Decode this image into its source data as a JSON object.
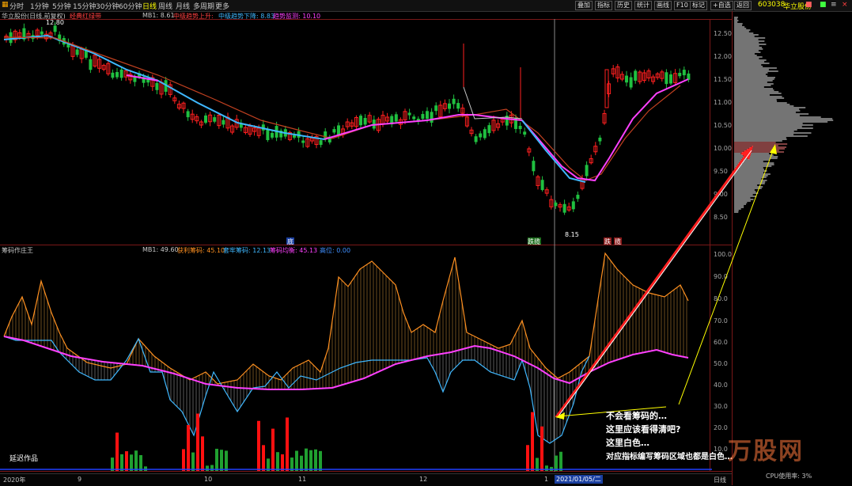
{
  "timeframes": [
    {
      "label": "分时",
      "active": false
    },
    {
      "label": "1分钟",
      "active": false
    },
    {
      "label": "5分钟",
      "active": false
    },
    {
      "label": "15分钟",
      "active": false
    },
    {
      "label": "30分钟",
      "active": false
    },
    {
      "label": "60分钟",
      "active": false
    },
    {
      "label": "日线",
      "active": true
    },
    {
      "label": "周线",
      "active": false
    },
    {
      "label": "月线",
      "active": false
    },
    {
      "label": "多周期",
      "active": false
    },
    {
      "label": "更多",
      "active": false
    }
  ],
  "toolbar": [
    "叠加",
    "指标",
    "历史",
    "统计",
    "画线",
    "F10",
    "标记",
    "+自选",
    "返回"
  ],
  "stock": {
    "code": "603038",
    "name": "华立股份"
  },
  "main_chart": {
    "title": "华立股份(日线,前复权)",
    "indicator": "经典红绿带",
    "legend": [
      {
        "text": "MB1: 8.61",
        "color": "#c8c8c8"
      },
      {
        "text": "中级趋势上升:",
        "color": "#ff4040"
      },
      {
        "text": "中级趋势下降: 8.83",
        "color": "#3fb8ff"
      },
      {
        "text": "趋势监测: 10.10",
        "color": "#ff40ff"
      }
    ],
    "price_labels": [
      "12.50",
      "12.00",
      "11.50",
      "11.00",
      "10.50",
      "10.00",
      "9.50",
      "9.00",
      "8.50"
    ],
    "high_mark": "12.80",
    "low_mark": "8.15",
    "signals": [
      "底",
      "跌揽",
      "跌",
      "揽"
    ]
  },
  "sub_chart": {
    "title": "筹码作庄王",
    "legend": [
      {
        "text": "MB1: 49.60",
        "color": "#c8c8c8"
      },
      {
        "text": "获利筹码: 45.10",
        "color": "#ff9020"
      },
      {
        "text": "套牢筹码: 12.13",
        "color": "#3fb8ff"
      },
      {
        "text": "筹码均衡: 45.13",
        "color": "#ff40ff"
      },
      {
        "text": "高位: 0.00",
        "color": "#3f8fff"
      }
    ],
    "y_labels": [
      "100.0",
      "90.0",
      "80.0",
      "70.0",
      "60.0",
      "50.0",
      "40.0",
      "30.0",
      "20.0",
      "10.0"
    ],
    "note": "延迟作品"
  },
  "annotation_lines": [
    "不会看筹码的…",
    "这里应该看得清吧?",
    "这里白色…",
    "对应指标编写筹码区域也都是白色…"
  ],
  "date_axis": [
    "2020年",
    "9",
    "10",
    "11",
    "12",
    "1",
    "2021/01/05/二"
  ],
  "status": {
    "label": "日线",
    "cpu": "CPU使用率: 3%"
  },
  "watermark": "万股网",
  "colors": {
    "up": "#ff2020",
    "down": "#20c040",
    "profit": "#ff9020",
    "trapped": "#3fb8ff",
    "balance": "#ff40ff",
    "annotation": "#ffff00"
  }
}
